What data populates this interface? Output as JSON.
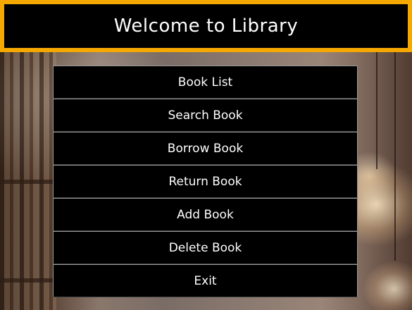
{
  "header": {
    "title": "Welcome to Library"
  },
  "menu": {
    "items": [
      {
        "label": "Book List"
      },
      {
        "label": "Search Book"
      },
      {
        "label": "Borrow Book"
      },
      {
        "label": "Return Book"
      },
      {
        "label": "Add Book"
      },
      {
        "label": "Delete Book"
      },
      {
        "label": "Exit"
      }
    ]
  },
  "colors": {
    "header_border": "#f5a800",
    "button_background": "#000000",
    "text": "#ffffff"
  }
}
